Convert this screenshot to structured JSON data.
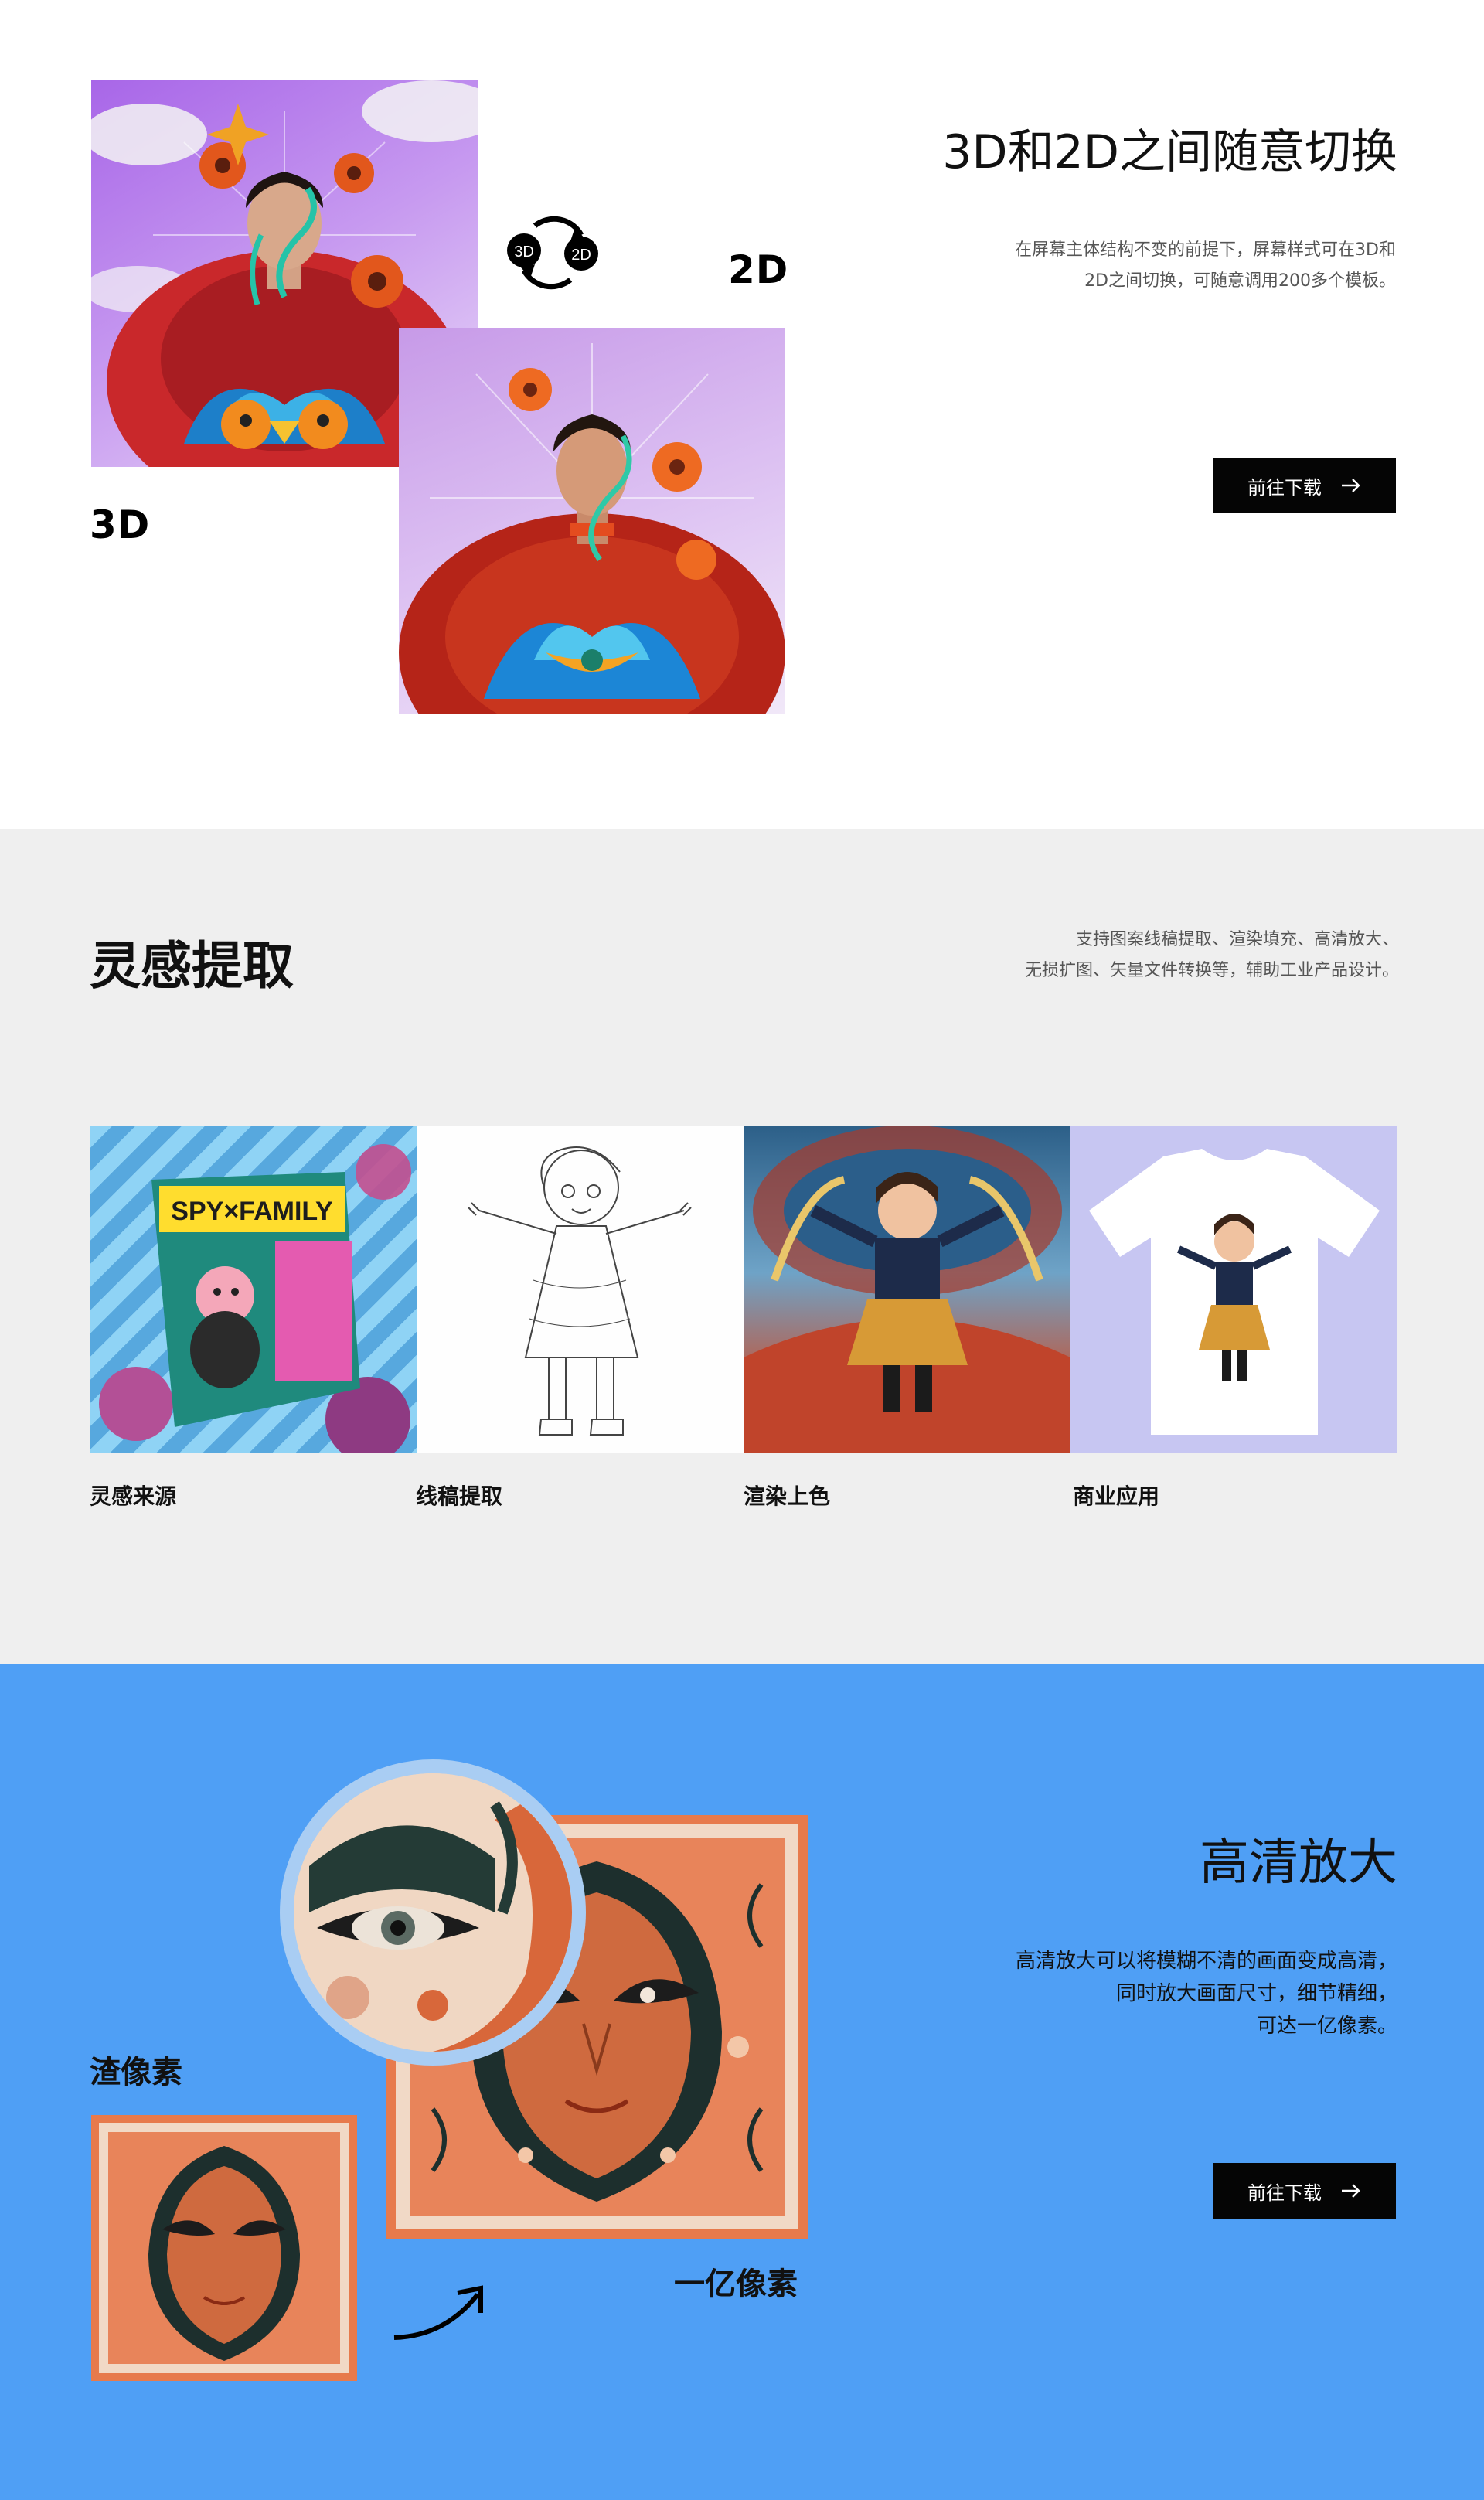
{
  "switch_section": {
    "title": "3D和2D之间随意切换",
    "description_line1": "在屏幕主体结构不变的前提下，屏幕样式可在3D和",
    "description_line2": "2D之间切换，可随意调用200多个模板。",
    "label_3d": "3D",
    "label_2d": "2D",
    "icon_text_3d": "3D",
    "icon_text_2d": "2D",
    "download_label": "前往下载"
  },
  "inspiration_section": {
    "title": "灵感提取",
    "description_line1": "支持图案线稿提取、渲染填充、高清放大、",
    "description_line2": "无损扩图、矢量文件转换等，辅助工业产品设计。",
    "cards": [
      {
        "label": "灵感来源",
        "image": "spy-family-package-image"
      },
      {
        "label": "线稿提取",
        "image": "line-art-girl-image"
      },
      {
        "label": "渲染上色",
        "image": "rendered-girl-image"
      },
      {
        "label": "商业应用",
        "image": "tshirt-print-image"
      }
    ]
  },
  "upscale_section": {
    "title": "高清放大",
    "description_line1": "高清放大可以将模糊不清的画面变成高清，",
    "description_line2": "同时放大画面尺寸，细节精细，",
    "description_line3": "可达一亿像素。",
    "low_res_label": "渣像素",
    "high_res_label": "一亿像素",
    "download_label": "前往下载"
  },
  "colors": {
    "section1_bg": "#ffffff",
    "section2_bg": "#efefef",
    "section3_bg": "#4f9ff5",
    "button_bg": "#050505",
    "button_text": "#ffffff"
  }
}
